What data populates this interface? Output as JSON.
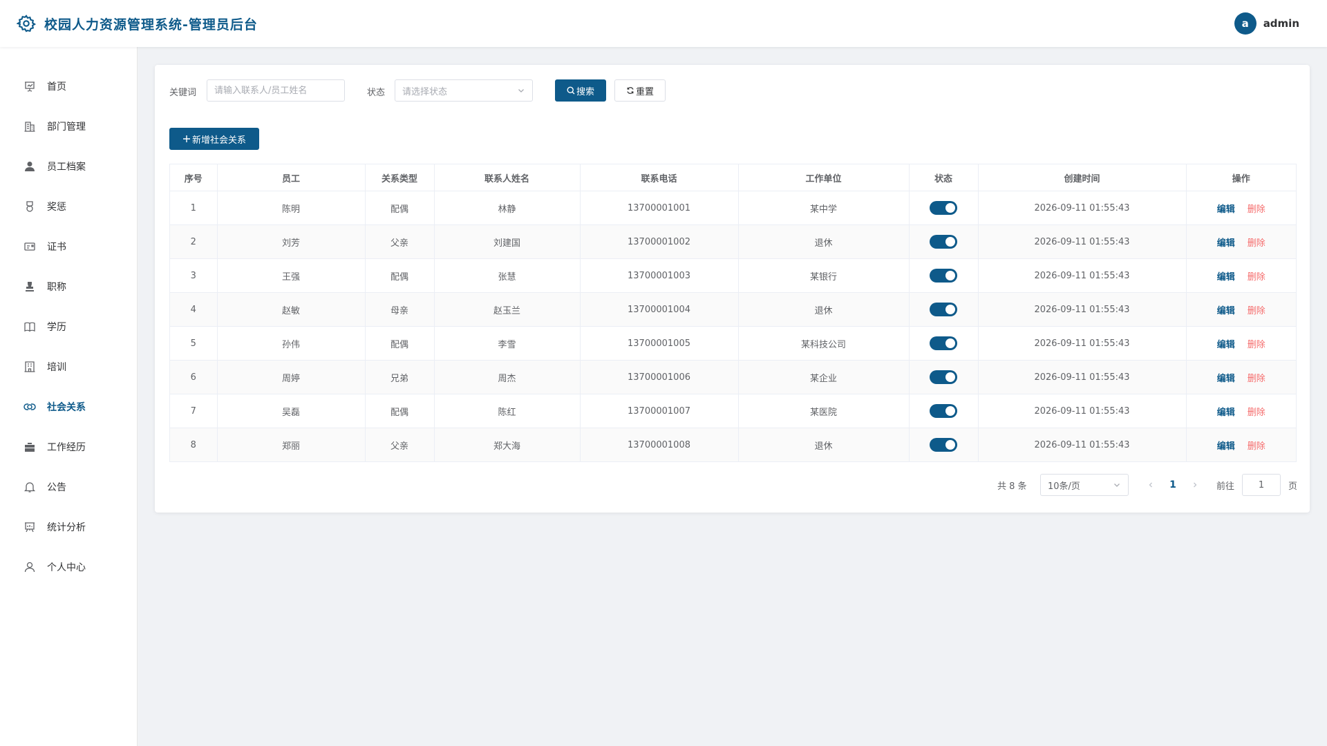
{
  "header": {
    "title": "校园人力资源管理系统-管理员后台",
    "user": {
      "avatar_letter": "a",
      "name": "admin"
    }
  },
  "sidebar": {
    "items": [
      {
        "label": "首页",
        "icon": "presentation-icon"
      },
      {
        "label": "部门管理",
        "icon": "building-icon"
      },
      {
        "label": "员工档案",
        "icon": "user-filled-icon"
      },
      {
        "label": "奖惩",
        "icon": "medal-icon"
      },
      {
        "label": "证书",
        "icon": "postcard-icon"
      },
      {
        "label": "职称",
        "icon": "stamp-icon"
      },
      {
        "label": "学历",
        "icon": "reading-icon"
      },
      {
        "label": "培训",
        "icon": "school-icon"
      },
      {
        "label": "社会关系",
        "icon": "connection-icon",
        "active": true
      },
      {
        "label": "工作经历",
        "icon": "suitcase-icon"
      },
      {
        "label": "公告",
        "icon": "bell-icon"
      },
      {
        "label": "统计分析",
        "icon": "data-board-icon"
      },
      {
        "label": "个人中心",
        "icon": "user-icon"
      }
    ]
  },
  "filters": {
    "keyword_label": "关键词",
    "keyword_placeholder": "请输入联系人/员工姓名",
    "keyword_value": "",
    "status_label": "状态",
    "status_placeholder": "请选择状态",
    "search_label": "搜索",
    "reset_label": "重置"
  },
  "add_button_label": "新增社会关系",
  "table": {
    "columns": [
      "序号",
      "员工",
      "关系类型",
      "联系人姓名",
      "联系电话",
      "工作单位",
      "状态",
      "创建时间",
      "操作"
    ],
    "rows": [
      {
        "no": "1",
        "employee": "陈明",
        "relation": "配偶",
        "contact": "林静",
        "phone": "13700001001",
        "workplace": "某中学",
        "status_on": true,
        "created": "2026-09-11 01:55:43"
      },
      {
        "no": "2",
        "employee": "刘芳",
        "relation": "父亲",
        "contact": "刘建国",
        "phone": "13700001002",
        "workplace": "退休",
        "status_on": true,
        "created": "2026-09-11 01:55:43"
      },
      {
        "no": "3",
        "employee": "王强",
        "relation": "配偶",
        "contact": "张慧",
        "phone": "13700001003",
        "workplace": "某银行",
        "status_on": true,
        "created": "2026-09-11 01:55:43"
      },
      {
        "no": "4",
        "employee": "赵敏",
        "relation": "母亲",
        "contact": "赵玉兰",
        "phone": "13700001004",
        "workplace": "退休",
        "status_on": true,
        "created": "2026-09-11 01:55:43"
      },
      {
        "no": "5",
        "employee": "孙伟",
        "relation": "配偶",
        "contact": "李雪",
        "phone": "13700001005",
        "workplace": "某科技公司",
        "status_on": true,
        "created": "2026-09-11 01:55:43"
      },
      {
        "no": "6",
        "employee": "周婷",
        "relation": "兄弟",
        "contact": "周杰",
        "phone": "13700001006",
        "workplace": "某企业",
        "status_on": true,
        "created": "2026-09-11 01:55:43"
      },
      {
        "no": "7",
        "employee": "吴磊",
        "relation": "配偶",
        "contact": "陈红",
        "phone": "13700001007",
        "workplace": "某医院",
        "status_on": true,
        "created": "2026-09-11 01:55:43"
      },
      {
        "no": "8",
        "employee": "郑丽",
        "relation": "父亲",
        "contact": "郑大海",
        "phone": "13700001008",
        "workplace": "退休",
        "status_on": true,
        "created": "2026-09-11 01:55:43"
      }
    ],
    "edit_label": "编辑",
    "delete_label": "删除"
  },
  "pagination": {
    "total_text": "共 8 条",
    "page_size": "10条/页",
    "current_page": "1",
    "goto_label": "前往",
    "goto_value": "1",
    "page_suffix": "页"
  },
  "colors": {
    "primary": "#0e5a8a",
    "danger": "#f56c6c",
    "background": "#f0f2f5"
  }
}
